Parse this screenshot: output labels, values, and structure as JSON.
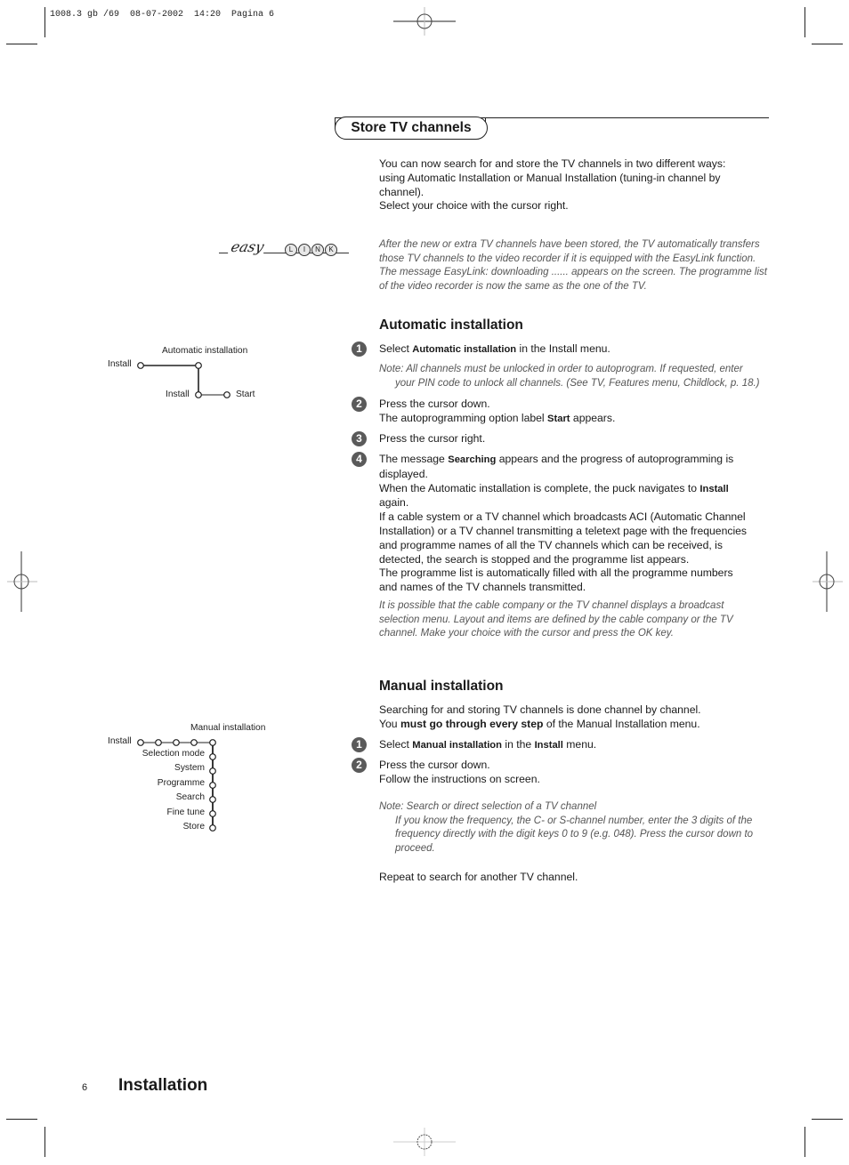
{
  "print_header": "1008.3 gb /69  08-07-2002  14:20  Pagina 6",
  "section_title": "Store TV channels",
  "intro": {
    "lines": [
      "You can now search for and store the TV channels in two different ways:",
      "using Automatic Installation or Manual Installation (tuning-in channel by",
      "channel).",
      "Select your choice with the cursor right."
    ]
  },
  "easylink": {
    "logo_script": "easy",
    "logo_letters": [
      "L",
      "I",
      "N",
      "K"
    ],
    "note_lines": [
      "After the new or extra TV channels have been stored, the TV automatically transfers",
      "those TV channels to the video recorder if it is equipped with the EasyLink function.",
      "The message EasyLink: downloading ...... appears on the screen.  The programme list",
      "of the video recorder is now the same as the one of the TV."
    ]
  },
  "auto_diagram": {
    "title": "Automatic installation",
    "root": "Install",
    "sub": "Install",
    "end": "Start"
  },
  "automatic": {
    "heading": "Automatic installation",
    "step1": {
      "num": "1",
      "pre": "Select ",
      "bold": "Automatic installation",
      "post": " in the Install menu."
    },
    "note1_line1": "Note: All channels must be unlocked in order to autoprogram. If requested, enter",
    "note1_line2": "your PIN code to unlock all channels. (See TV, Features menu, Childlock, p. 18.)",
    "step2": {
      "num": "2",
      "line1": "Press the cursor down.",
      "pre": "The autoprogramming option label ",
      "bold": "Start",
      "post": " appears."
    },
    "step3": {
      "num": "3",
      "line1": "Press the cursor right."
    },
    "step4": {
      "num": "4",
      "pre": "The message ",
      "bold": "Searching",
      "post": " appears and the progress of autoprogramming is",
      "l2": "displayed.",
      "l3_pre": "When the Automatic installation is complete, the puck navigates to ",
      "l3_bold": "Install",
      "l4": "again.",
      "l5": "If a cable system or a TV channel which broadcasts ACI (Automatic Channel",
      "l6": "Installation) or a TV channel transmitting a teletext page with the frequencies",
      "l7": "and programme names of all the TV channels which can be received, is",
      "l8": "detected, the search is stopped and the programme list appears.",
      "l9": "The programme list is automatically filled with all the programme numbers",
      "l10": "and names of the TV channels transmitted."
    },
    "note2_lines": [
      "It is possible that the cable company or the TV channel displays a broadcast",
      "selection menu. Layout and items are defined by the cable company or the TV",
      "channel. Make your choice with the cursor and press the OK key."
    ]
  },
  "manual_diagram": {
    "title": "Manual installation",
    "root": "Install",
    "items": [
      "Selection mode",
      "System",
      "Programme",
      "Search",
      "Fine tune",
      "Store"
    ]
  },
  "manual": {
    "heading": "Manual installation",
    "intro1": "Searching for and storing TV channels is done channel by channel.",
    "intro2_pre": "You ",
    "intro2_bold": "must go through every step",
    "intro2_post": " of the Manual Installation menu.",
    "step1": {
      "num": "1",
      "pre": "Select ",
      "bold": "Manual installation",
      "mid": " in the ",
      "bold2": "Install",
      "post": " menu."
    },
    "step2": {
      "num": "2",
      "line1": "Press the cursor down.",
      "line2": "Follow the instructions on screen."
    },
    "note_title": "Note: Search or direct selection of a TV channel",
    "note_lines": [
      "If you know the frequency, the C- or S-channel number, enter the 3 digits of the",
      "frequency directly with the digit keys 0 to 9 (e.g. 048). Press the cursor down to",
      "proceed."
    ],
    "repeat": "Repeat to search for another TV channel."
  },
  "footer": {
    "page_number": "6",
    "title": "Installation"
  }
}
